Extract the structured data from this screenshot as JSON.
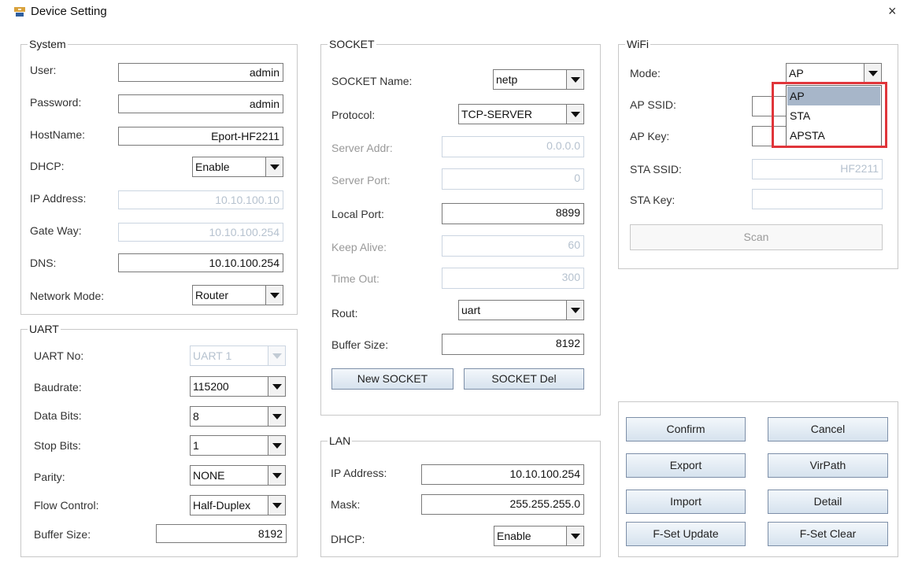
{
  "window": {
    "title": "Device Setting",
    "close_glyph": "×"
  },
  "system": {
    "title": "System",
    "user_label": "User:",
    "user_value": "admin",
    "password_label": "Password:",
    "password_value": "admin",
    "hostname_label": "HostName:",
    "hostname_value": "Eport-HF2211",
    "dhcp_label": "DHCP:",
    "dhcp_value": "Enable",
    "ip_label": "IP Address:",
    "ip_value": "10.10.100.10",
    "gateway_label": "Gate Way:",
    "gateway_value": "10.10.100.254",
    "dns_label": "DNS:",
    "dns_value": "10.10.100.254",
    "netmode_label": "Network Mode:",
    "netmode_value": "Router"
  },
  "uart": {
    "title": "UART",
    "uartno_label": "UART No:",
    "uartno_value": "UART 1",
    "baud_label": "Baudrate:",
    "baud_value": "115200",
    "databits_label": "Data Bits:",
    "databits_value": "8",
    "stopbits_label": "Stop Bits:",
    "stopbits_value": "1",
    "parity_label": "Parity:",
    "parity_value": "NONE",
    "flow_label": "Flow Control:",
    "flow_value": "Half-Duplex",
    "buffer_label": "Buffer Size:",
    "buffer_value": "8192"
  },
  "socket": {
    "title": "SOCKET",
    "name_label": "SOCKET Name:",
    "name_value": "netp",
    "protocol_label": "Protocol:",
    "protocol_value": "TCP-SERVER",
    "server_addr_label": "Server Addr:",
    "server_addr_value": "0.0.0.0",
    "server_port_label": "Server Port:",
    "server_port_value": "0",
    "local_port_label": "Local Port:",
    "local_port_value": "8899",
    "keepalive_label": "Keep Alive:",
    "keepalive_value": "60",
    "timeout_label": "Time Out:",
    "timeout_value": "300",
    "rout_label": "Rout:",
    "rout_value": "uart",
    "buffer_label": "Buffer Size:",
    "buffer_value": "8192",
    "new_button": "New SOCKET",
    "del_button": "SOCKET Del"
  },
  "lan": {
    "title": "LAN",
    "ip_label": "IP Address:",
    "ip_value": "10.10.100.254",
    "mask_label": "Mask:",
    "mask_value": "255.255.255.0",
    "dhcp_label": "DHCP:",
    "dhcp_value": "Enable"
  },
  "wifi": {
    "title": "WiFi",
    "mode_label": "Mode:",
    "mode_value": "AP",
    "apssid_label": "AP SSID:",
    "apkey_label": "AP Key:",
    "stassid_label": "STA SSID:",
    "stassid_value": "HF2211",
    "stakey_label": "STA Key:",
    "scan_button": "Scan",
    "mode_options": [
      "AP",
      "STA",
      "APSTA"
    ]
  },
  "actions": {
    "confirm": "Confirm",
    "cancel": "Cancel",
    "export": "Export",
    "virpath": "VirPath",
    "import": "Import",
    "detail": "Detail",
    "fset_update": "F-Set Update",
    "fset_clear": "F-Set Clear"
  },
  "colors": {
    "highlight": "#e0353a",
    "selected_option": "#a7b6c9"
  },
  "icons": {
    "app": "device-setting-app-icon",
    "close": "close-icon",
    "dropdown": "chevron-down-icon"
  }
}
